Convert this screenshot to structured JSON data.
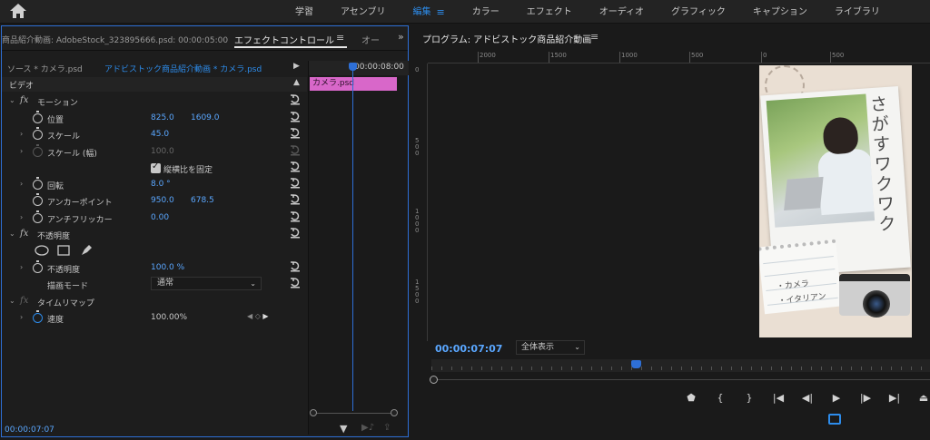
{
  "workspaces": {
    "tabs": [
      {
        "label": "学習"
      },
      {
        "label": "アセンブリ"
      },
      {
        "label": "編集"
      },
      {
        "label": "カラー"
      },
      {
        "label": "エフェクト"
      },
      {
        "label": "オーディオ"
      },
      {
        "label": "グラフィック"
      },
      {
        "label": "キャプション"
      },
      {
        "label": "ライブラリ"
      }
    ],
    "active": "編集",
    "menu_glyph": "≡"
  },
  "effect_controls": {
    "clip_path": "商品紹介動画: AdobeStock_323895666.psd: 00:00:05:00",
    "tab_label": "エフェクトコントロール",
    "menu_glyph": "≡",
    "audio_tab": "オー",
    "overflow_glyph": "»",
    "source_label": "ソース * カメラ.psd",
    "sequence_label": "アドビストック商品紹介動画 * カメラ.psd",
    "video_label": "ビデオ",
    "motion": {
      "name": "モーション",
      "position": {
        "label": "位置",
        "x": "825.0",
        "y": "1609.0"
      },
      "scale": {
        "label": "スケール",
        "value": "45.0"
      },
      "scale_width": {
        "label": "スケール (幅)",
        "value": "100.0"
      },
      "uniform_scale": {
        "label": "縦横比を固定",
        "checked": true
      },
      "rotation": {
        "label": "回転",
        "value": "8.0 °"
      },
      "anchor": {
        "label": "アンカーポイント",
        "x": "950.0",
        "y": "678.5"
      },
      "antiflicker": {
        "label": "アンチフリッカー",
        "value": "0.00"
      }
    },
    "opacity": {
      "name": "不透明度",
      "opacity": {
        "label": "不透明度",
        "value": "100.0 %"
      },
      "blend_mode": {
        "label": "描画モード",
        "value": "通常"
      }
    },
    "time_remap": {
      "name": "タイムリマップ",
      "speed": {
        "label": "速度",
        "value": "100.00%"
      }
    },
    "timeline": {
      "timecode": "00:00:08:00",
      "clip_label": "カメラ.psd"
    },
    "current_timecode": "00:00:07:07"
  },
  "program_monitor": {
    "title": "プログラム: アドビストック商品紹介動画",
    "menu_glyph": "≡",
    "ruler_labels": [
      "2000",
      "1500",
      "1000",
      "500",
      "0",
      "500"
    ],
    "vruler_labels": [
      "0",
      "500",
      "1000",
      "1500"
    ],
    "preview": {
      "headline": "さがすワクワク",
      "note_line1": "・カメラ",
      "note_line2": "・イタリアン"
    },
    "timecode": "00:00:07:07",
    "zoom": "全体表示",
    "playhead_fraction": 0.41,
    "transport": [
      {
        "name": "marker",
        "glyph": "⬟"
      },
      {
        "name": "mark-in",
        "glyph": "{"
      },
      {
        "name": "mark-out",
        "glyph": "}"
      },
      {
        "name": "go-to-in",
        "glyph": "|◀"
      },
      {
        "name": "step-back",
        "glyph": "◀|"
      },
      {
        "name": "play",
        "glyph": "▶"
      },
      {
        "name": "step-forward",
        "glyph": "|▶"
      },
      {
        "name": "go-to-out",
        "glyph": "▶|"
      },
      {
        "name": "lift",
        "glyph": "⏏"
      }
    ]
  },
  "colors": {
    "accent": "#2d8ceb",
    "value_blue": "#5aa7ff",
    "clip_pink": "#d867c9",
    "panel_border": "#2e6fd6"
  }
}
